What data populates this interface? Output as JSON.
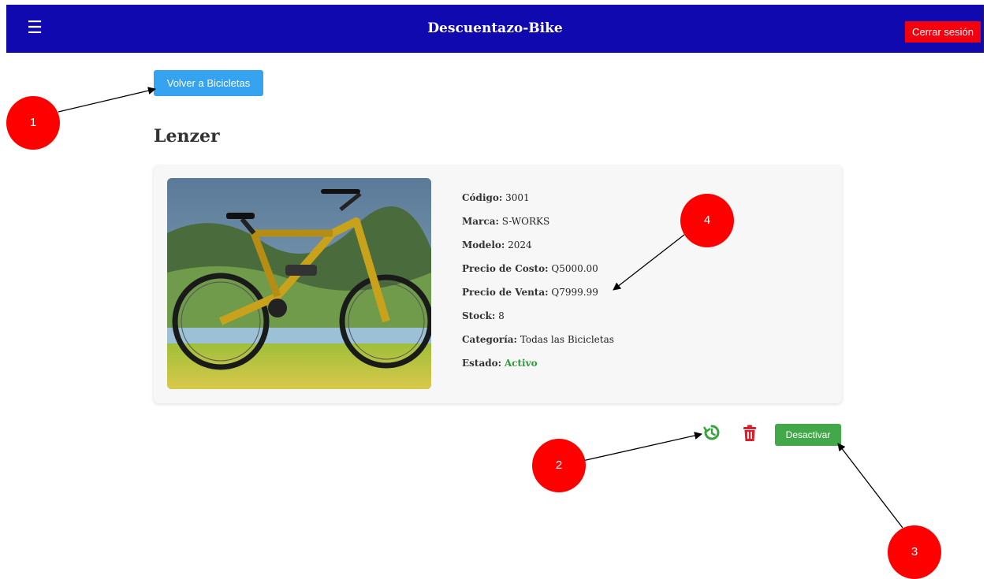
{
  "header": {
    "menu_icon": "hamburger-menu-icon",
    "title": "Descuentazo-Bike",
    "logout_label": "Cerrar sesión",
    "bg_color": "#1109b0",
    "logout_color": "#f3000f"
  },
  "back_button": {
    "label": "Volver a Bicicletas",
    "color": "#35a3ef"
  },
  "product": {
    "name": "Lenzer",
    "image_icon": "bike-photo",
    "details": [
      {
        "label": "Código:",
        "value": "3001"
      },
      {
        "label": "Marca:",
        "value": "S-WORKS"
      },
      {
        "label": "Modelo:",
        "value": "2024"
      },
      {
        "label": "Precio de Costo:",
        "value": "Q5000.00"
      },
      {
        "label": "Precio de Venta:",
        "value": "Q7999.99"
      },
      {
        "label": "Stock:",
        "value": "8"
      },
      {
        "label": "Categoría:",
        "value": "Todas las Bicicletas"
      },
      {
        "label": "Estado:",
        "value": "Activo"
      }
    ],
    "status_color": "#2e9c3a"
  },
  "actions": {
    "restore_icon": "restore-history-icon",
    "delete_icon": "trash-icon",
    "deactivate_label": "Desactivar",
    "deactivate_color": "#43a84a"
  },
  "callouts": [
    {
      "number": "1"
    },
    {
      "number": "2"
    },
    {
      "number": "3"
    },
    {
      "number": "4"
    }
  ]
}
